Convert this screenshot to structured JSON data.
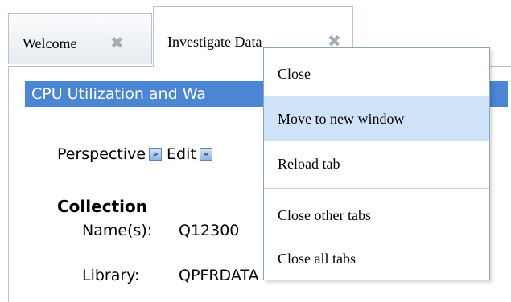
{
  "tabs": [
    {
      "label": "Welcome",
      "close": "✖"
    },
    {
      "label": "Investigate Data",
      "close": "✖"
    }
  ],
  "panel": {
    "title": "CPU Utilization and Wa",
    "perspective_label": "Perspective",
    "edit_label": "Edit",
    "collection_heading": "Collection",
    "fields": [
      {
        "label": "Name(s):",
        "value": "Q12300"
      },
      {
        "label": "Library:",
        "value": "QPFRDATA"
      }
    ]
  },
  "context_menu": {
    "items": [
      {
        "label": "Close"
      },
      {
        "label": "Move to new window"
      },
      {
        "label": "Reload tab"
      },
      {
        "label": "Close other tabs"
      },
      {
        "label": "Close all tabs"
      }
    ],
    "highlighted_item": "Move to new window"
  },
  "colors": {
    "title_bar": "#4a86d4",
    "menu_highlight": "#cfe3f8",
    "tab_border": "#b9c3cf"
  },
  "icons": {
    "tab_close": "close-icon",
    "perspective_arrow": "double-arrow-icon"
  }
}
